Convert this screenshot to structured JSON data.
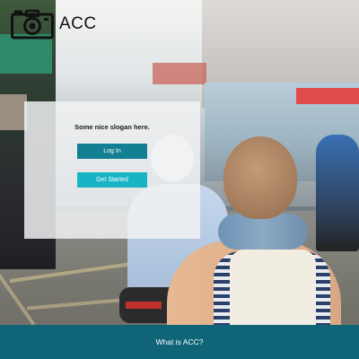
{
  "brand": {
    "name": "ACC",
    "logo_icon": "camera-icon"
  },
  "hero": {
    "slogan": "Some nice slogan here."
  },
  "buttons": {
    "login_label": "Log In",
    "get_started_label": "Get Started"
  },
  "footer": {
    "link_label": "What is ACC?"
  },
  "colors": {
    "primary_dark": "#127f92",
    "primary_light": "#19b3c6",
    "footer_bg": "#0f6577",
    "card_bg": "#f2f3f4"
  }
}
